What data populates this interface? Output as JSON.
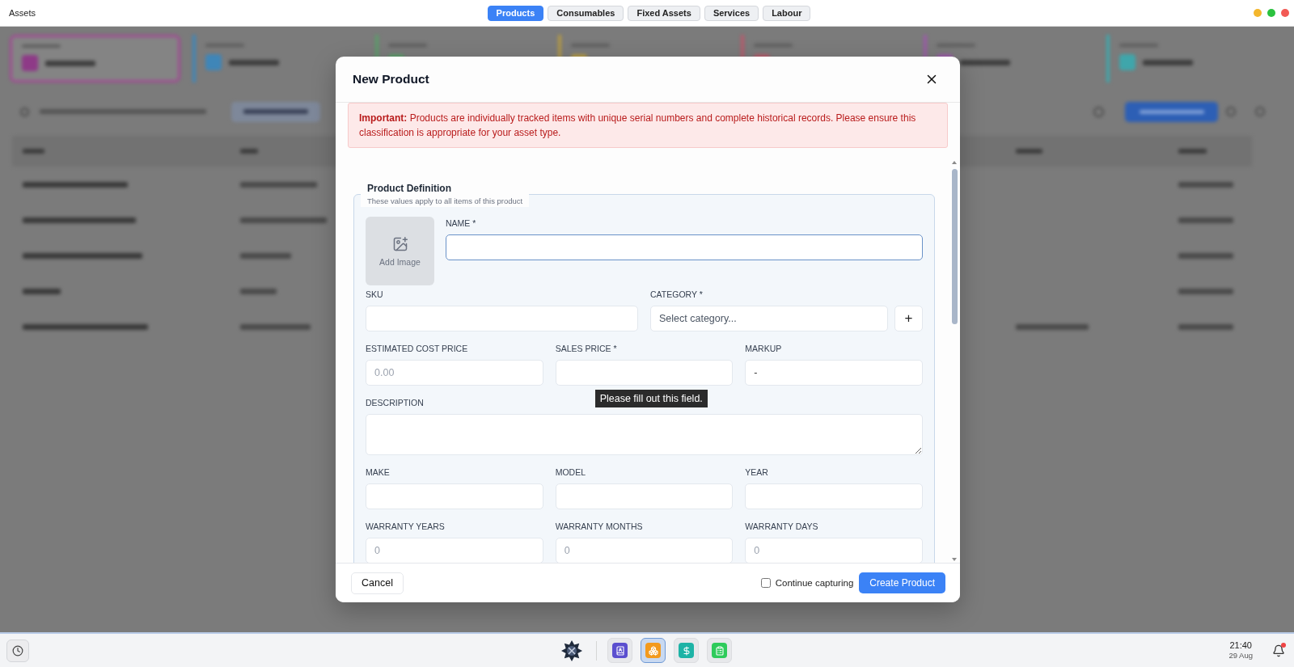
{
  "window": {
    "title": "Assets"
  },
  "tabs": [
    {
      "label": "Products",
      "selected": true
    },
    {
      "label": "Consumables",
      "selected": false
    },
    {
      "label": "Fixed Assets",
      "selected": false
    },
    {
      "label": "Services",
      "selected": false
    },
    {
      "label": "Labour",
      "selected": false
    }
  ],
  "dialog": {
    "title": "New Product",
    "notice": "**Important:** Products are individually tracked items with unique serial numbers and complete historical records. Please ensure this classification is appropriate for your asset type.",
    "section": {
      "title": "Product Definition",
      "subtitle": "These values apply to all items of this product",
      "image_button": "Add Image",
      "name_field": {
        "label": "NAME *",
        "focused": true
      },
      "rows": [
        {
          "fields": [
            {
              "kind": "text",
              "label": "SKU"
            },
            {
              "kind": "select",
              "label": "CATEGORY *",
              "placeholder": "Select category...",
              "add_button": "+"
            }
          ]
        },
        {
          "fields": [
            {
              "kind": "text",
              "label": "ESTIMATED COST PRICE",
              "placeholder": "0.00"
            },
            {
              "kind": "text",
              "label": "SALES PRICE *",
              "validation_message": "Please fill out this field."
            },
            {
              "kind": "text",
              "label": "MARKUP",
              "value": "-"
            }
          ]
        },
        {
          "fields": [
            {
              "kind": "textarea",
              "label": "DESCRIPTION"
            }
          ]
        },
        {
          "fields": [
            {
              "kind": "text",
              "label": "MAKE"
            },
            {
              "kind": "text",
              "label": "MODEL"
            },
            {
              "kind": "text",
              "label": "YEAR"
            }
          ]
        },
        {
          "fields": [
            {
              "kind": "text",
              "label": "WARRANTY YEARS",
              "placeholder": "0"
            },
            {
              "kind": "text",
              "label": "WARRANTY MONTHS",
              "placeholder": "0"
            },
            {
              "kind": "text",
              "label": "WARRANTY DAYS",
              "placeholder": "0"
            }
          ]
        }
      ]
    },
    "footer": {
      "cancel": "Cancel",
      "continue_capturing": {
        "label": "Continue capturing",
        "checked": false
      },
      "submit": "Create Product"
    }
  },
  "taskbar": {
    "apps": [
      {
        "kind": "book",
        "color": "#5b4fcf",
        "selected": false
      },
      {
        "kind": "boxes",
        "color": "#f39a1e",
        "selected": true
      },
      {
        "kind": "dollar",
        "color": "#1db3a6",
        "selected": false
      },
      {
        "kind": "clipboard",
        "color": "#2ecb5b",
        "selected": false
      }
    ],
    "time": "21:40",
    "date": "29 Aug",
    "notification": true
  }
}
